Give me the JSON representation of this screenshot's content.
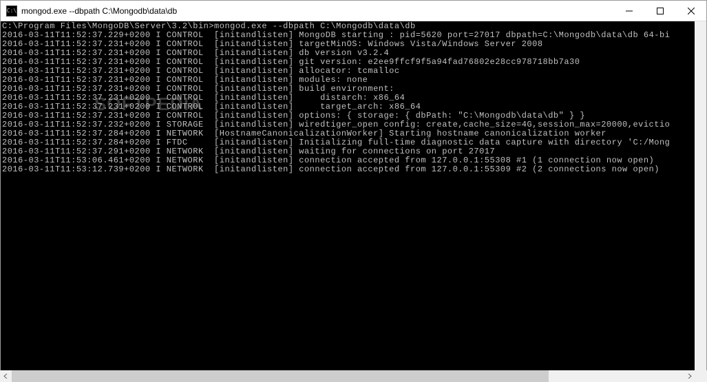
{
  "titlebar": {
    "icon_glyph": "C:\\",
    "title": "mongod.exe  --dbpath C:\\Mongodb\\data\\db"
  },
  "watermark": "SOFTPEDIA",
  "console": {
    "lines": [
      "",
      "C:\\Program Files\\MongoDB\\Server\\3.2\\bin>mongod.exe --dbpath C:\\Mongodb\\data\\db",
      "2016-03-11T11:52:37.229+0200 I CONTROL  [initandlisten] MongoDB starting : pid=5620 port=27017 dbpath=C:\\Mongodb\\data\\db 64-bi",
      "2016-03-11T11:52:37.231+0200 I CONTROL  [initandlisten] targetMinOS: Windows Vista/Windows Server 2008",
      "2016-03-11T11:52:37.231+0200 I CONTROL  [initandlisten] db version v3.2.4",
      "2016-03-11T11:52:37.231+0200 I CONTROL  [initandlisten] git version: e2ee9ffcf9f5a94fad76802e28cc978718bb7a30",
      "2016-03-11T11:52:37.231+0200 I CONTROL  [initandlisten] allocator: tcmalloc",
      "2016-03-11T11:52:37.231+0200 I CONTROL  [initandlisten] modules: none",
      "2016-03-11T11:52:37.231+0200 I CONTROL  [initandlisten] build environment:",
      "2016-03-11T11:52:37.231+0200 I CONTROL  [initandlisten]     distarch: x86_64",
      "2016-03-11T11:52:37.231+0200 I CONTROL  [initandlisten]     target_arch: x86_64",
      "2016-03-11T11:52:37.231+0200 I CONTROL  [initandlisten] options: { storage: { dbPath: \"C:\\Mongodb\\data\\db\" } }",
      "2016-03-11T11:52:37.232+0200 I STORAGE  [initandlisten] wiredtiger_open config: create,cache_size=4G,session_max=20000,evictio",
      "2016-03-11T11:52:37.284+0200 I NETWORK  [HostnameCanonicalizationWorker] Starting hostname canonicalization worker",
      "2016-03-11T11:52:37.284+0200 I FTDC     [initandlisten] Initializing full-time diagnostic data capture with directory 'C:/Mong",
      "2016-03-11T11:52:37.291+0200 I NETWORK  [initandlisten] waiting for connections on port 27017",
      "2016-03-11T11:53:06.461+0200 I NETWORK  [initandlisten] connection accepted from 127.0.0.1:55308 #1 (1 connection now open)",
      "2016-03-11T11:53:12.739+0200 I NETWORK  [initandlisten] connection accepted from 127.0.0.1:55309 #2 (2 connections now open)"
    ]
  }
}
